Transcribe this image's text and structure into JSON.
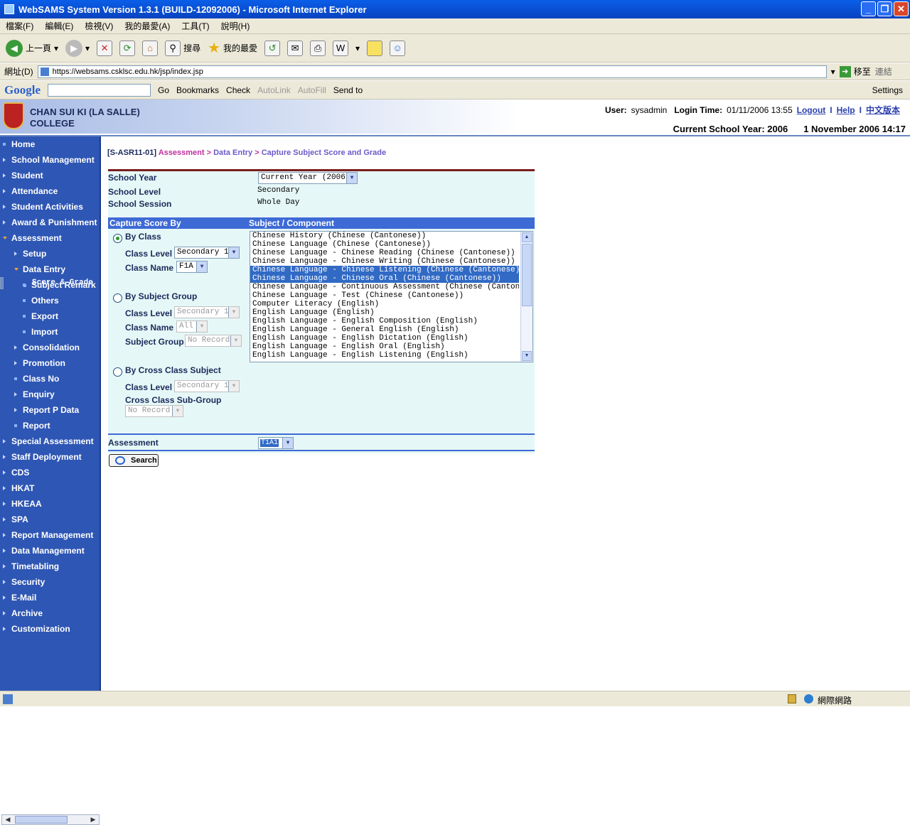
{
  "window": {
    "title": "WebSAMS System Version 1.3.1 (BUILD-12092006) - Microsoft Internet Explorer"
  },
  "menu": [
    "檔案(F)",
    "編輯(E)",
    "檢視(V)",
    "我的最愛(A)",
    "工具(T)",
    "說明(H)"
  ],
  "toolbar": {
    "back": "上一頁",
    "search": "搜尋",
    "favorites": "我的最愛"
  },
  "address": {
    "label": "網址(D)",
    "url": "https://websams.csklsc.edu.hk/jsp/index.jsp",
    "go": "移至",
    "links": "連結"
  },
  "googlebar": {
    "logo": "Google",
    "go": "Go",
    "bookmarks": "Bookmarks",
    "check": "Check",
    "autolink": "AutoLink",
    "autofill": "AutoFill",
    "sendto": "Send to",
    "settings": "Settings"
  },
  "header": {
    "school_line1": "CHAN SUI KI (LA SALLE)",
    "school_line2": "COLLEGE",
    "user_label": "User:",
    "user": "sysadmin",
    "login_label": "Login Time:",
    "login_time": "01/11/2006 13:55",
    "logout": "Logout",
    "help": "Help",
    "chinese": "中文版本",
    "school_year": "Current School Year: 2006",
    "date": "1 November 2006 14:17"
  },
  "sidebar": [
    {
      "label": "Home",
      "level": 0,
      "marker": "dot"
    },
    {
      "label": "School Management",
      "level": 0,
      "marker": "arrow"
    },
    {
      "label": "Student",
      "level": 0,
      "marker": "arrow"
    },
    {
      "label": "Attendance",
      "level": 0,
      "marker": "arrow"
    },
    {
      "label": "Student Activities",
      "level": 0,
      "marker": "arrow"
    },
    {
      "label": "Award & Punishment",
      "level": 0,
      "marker": "arrow"
    },
    {
      "label": "Assessment",
      "level": 0,
      "marker": "open"
    },
    {
      "label": "Setup",
      "level": 1,
      "marker": "arrow"
    },
    {
      "label": "Data Entry",
      "level": 1,
      "marker": "open"
    },
    {
      "label": "Score & Grade",
      "level": 2,
      "marker": "dot",
      "selected": true
    },
    {
      "label": "Subject Remark",
      "level": 2,
      "marker": "dot"
    },
    {
      "label": "Others",
      "level": 2,
      "marker": "dot"
    },
    {
      "label": "Export",
      "level": 2,
      "marker": "dot"
    },
    {
      "label": "Import",
      "level": 2,
      "marker": "dot"
    },
    {
      "label": "Consolidation",
      "level": 1,
      "marker": "arrow"
    },
    {
      "label": "Promotion",
      "level": 1,
      "marker": "arrow"
    },
    {
      "label": "Class No",
      "level": 1,
      "marker": "dot"
    },
    {
      "label": "Enquiry",
      "level": 1,
      "marker": "arrow"
    },
    {
      "label": "Report P Data",
      "level": 1,
      "marker": "arrow"
    },
    {
      "label": "Report",
      "level": 1,
      "marker": "dot"
    },
    {
      "label": "Special Assessment",
      "level": 0,
      "marker": "arrow"
    },
    {
      "label": "Staff Deployment",
      "level": 0,
      "marker": "arrow"
    },
    {
      "label": "CDS",
      "level": 0,
      "marker": "arrow"
    },
    {
      "label": "HKAT",
      "level": 0,
      "marker": "arrow"
    },
    {
      "label": "HKEAA",
      "level": 0,
      "marker": "arrow"
    },
    {
      "label": "SPA",
      "level": 0,
      "marker": "arrow"
    },
    {
      "label": "Report Management",
      "level": 0,
      "marker": "arrow"
    },
    {
      "label": "Data Management",
      "level": 0,
      "marker": "arrow"
    },
    {
      "label": "Timetabling",
      "level": 0,
      "marker": "arrow"
    },
    {
      "label": "Security",
      "level": 0,
      "marker": "arrow"
    },
    {
      "label": "E-Mail",
      "level": 0,
      "marker": "arrow"
    },
    {
      "label": "Archive",
      "level": 0,
      "marker": "arrow"
    },
    {
      "label": "Customization",
      "level": 0,
      "marker": "arrow"
    }
  ],
  "breadcrumb": {
    "code": "[S-ASR11-01]",
    "module": "Assessment",
    "sep1": " > ",
    "sub": "Data Entry",
    "sep2": " > ",
    "page": "Capture Subject Score and Grade"
  },
  "form": {
    "school_year_label": "School Year",
    "school_year_value": "Current Year (2006)",
    "school_level_label": "School Level",
    "school_level_value": "Secondary",
    "school_session_label": "School Session",
    "school_session_value": "Whole Day",
    "capture_by_header": "Capture Score By",
    "subject_header": "Subject / Component",
    "by_class": "By Class",
    "class_level_label": "Class Level",
    "class_level_value": "Secondary 1",
    "class_name_label": "Class Name",
    "class_name_value": "F1A",
    "by_subject_group": "By Subject Group",
    "sg_class_level_value": "Secondary 1",
    "sg_class_name_value": "All",
    "subject_group_label": "Subject Group",
    "subject_group_value": "No Record",
    "by_cross_class": "By Cross Class Subject",
    "cc_class_level_value": "Secondary 1",
    "cross_class_sub_group_label": "Cross Class Sub-Group",
    "cc_sub_group_value": "No Record",
    "assessment_label": "Assessment",
    "assessment_value": "T1A1",
    "search_button": "Search"
  },
  "subjects": [
    {
      "text": "Chinese History (Chinese (Cantonese))",
      "selected": false
    },
    {
      "text": "Chinese Language (Chinese (Cantonese))",
      "selected": false
    },
    {
      "text": "Chinese Language - Chinese Reading (Chinese (Cantonese))",
      "selected": false
    },
    {
      "text": "Chinese Language - Chinese Writing (Chinese (Cantonese))",
      "selected": false
    },
    {
      "text": "Chinese Language - Chinese Listening (Chinese (Cantonese))",
      "selected": true
    },
    {
      "text": "Chinese Language - Chinese Oral (Chinese (Cantonese))",
      "selected": true
    },
    {
      "text": "Chinese Language - Continuous Assessment (Chinese (Cantonese))",
      "selected": false
    },
    {
      "text": "Chinese Language - Test (Chinese (Cantonese))",
      "selected": false
    },
    {
      "text": "Computer Literacy (English)",
      "selected": false
    },
    {
      "text": "English Language (English)",
      "selected": false
    },
    {
      "text": "English Language - English Composition (English)",
      "selected": false
    },
    {
      "text": "English Language - General English (English)",
      "selected": false
    },
    {
      "text": "English Language - English Dictation (English)",
      "selected": false
    },
    {
      "text": "English Language - English Oral (English)",
      "selected": false
    },
    {
      "text": "English Language - English Listening (English)",
      "selected": false
    }
  ],
  "status": {
    "zone": "網際網路"
  }
}
